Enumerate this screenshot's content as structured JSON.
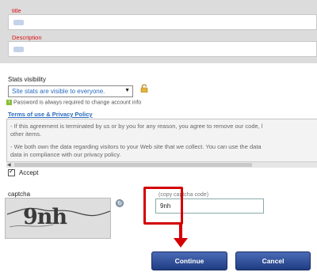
{
  "form": {
    "title_label": "title",
    "description_label": "Description"
  },
  "stats": {
    "label": "Stats visibility",
    "selected": "Site stats are visible to everyone.",
    "info": "Password is always required to change account info"
  },
  "terms": {
    "link": "Terms of use & Privacy Policy",
    "paragraphs": [
      "- If this agreement is terminated by us or by you for any reason, you agree to remove our code, l",
      "other items.",
      "- We both own the data regarding visitors to your Web site that we collect. You can use the data",
      "data in compliance with our privacy policy."
    ]
  },
  "accept": {
    "label": "Accept"
  },
  "captcha": {
    "label": "captcha",
    "image_text": "9nh",
    "hint": "(copy captcha code)",
    "input_value": "9nh"
  },
  "buttons": {
    "continue": "Continue",
    "cancel": "Cancel"
  },
  "colors": {
    "label_red": "#dd1111",
    "annotation_red": "#d40000",
    "button_blue": "#1f3c82",
    "link_blue": "#2a6bbf"
  }
}
